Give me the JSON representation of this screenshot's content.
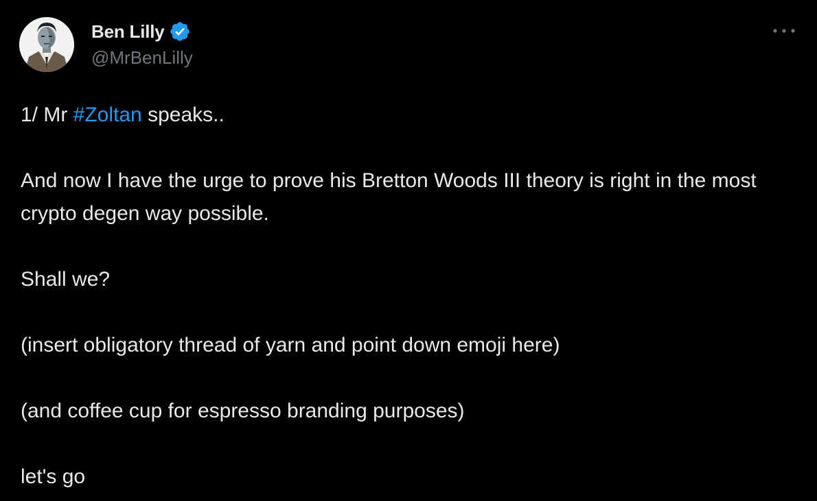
{
  "author": {
    "display_name": "Ben Lilly",
    "handle": "@MrBenLilly",
    "verified": true,
    "verified_color": "#1d9bf0"
  },
  "icons": {
    "verified": "verified-badge-icon",
    "more": "more-options-icon"
  },
  "tweet": {
    "line1_prefix": "1/ Mr ",
    "hashtag": "#Zoltan",
    "line1_suffix": " speaks..",
    "paragraph2": "And now I have the urge to prove his Bretton Woods III theory is right in the most crypto degen way possible.",
    "paragraph3": "Shall we?",
    "paragraph4": "(insert obligatory thread of yarn and point down emoji here)",
    "paragraph5": "(and coffee cup for espresso branding purposes)",
    "paragraph6": "let's go"
  },
  "colors": {
    "background": "#000000",
    "text": "#e7e9ea",
    "secondary_text": "#71767b",
    "link": "#1d9bf0"
  }
}
